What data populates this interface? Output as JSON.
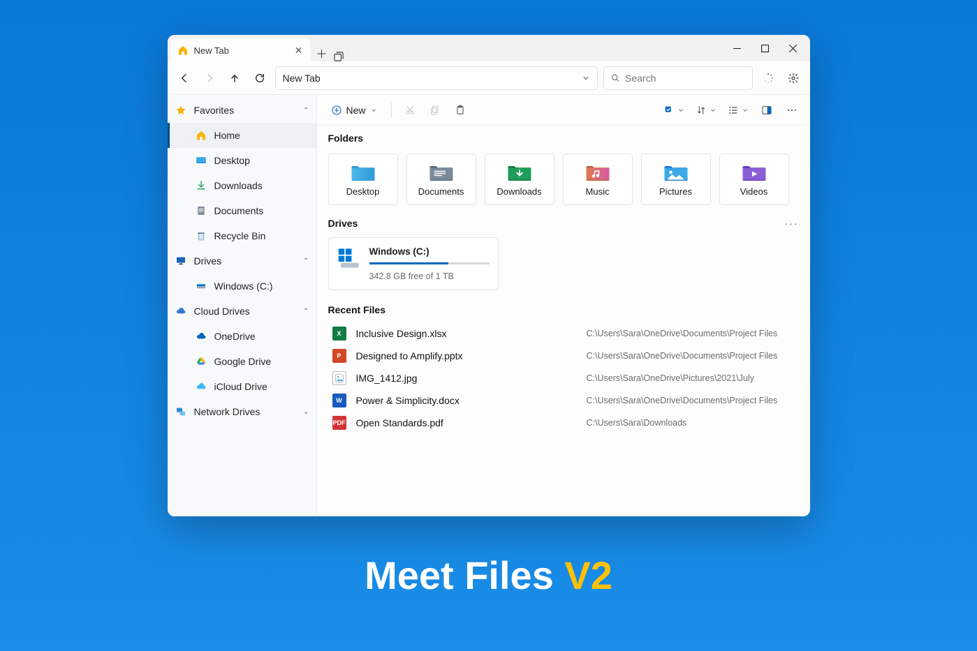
{
  "tab": {
    "title": "New Tab"
  },
  "address": {
    "value": "New Tab"
  },
  "search": {
    "placeholder": "Search"
  },
  "toolbar": {
    "new_label": "New"
  },
  "sidebar": {
    "favorites": {
      "title": "Favorites",
      "items": [
        {
          "label": "Home",
          "icon": "home",
          "active": true
        },
        {
          "label": "Desktop",
          "icon": "desktop"
        },
        {
          "label": "Downloads",
          "icon": "downloads"
        },
        {
          "label": "Documents",
          "icon": "documents"
        },
        {
          "label": "Recycle Bin",
          "icon": "recycle"
        }
      ]
    },
    "drives": {
      "title": "Drives",
      "items": [
        {
          "label": "Windows (C:)",
          "icon": "drive"
        }
      ]
    },
    "cloud": {
      "title": "Cloud Drives",
      "items": [
        {
          "label": "OneDrive",
          "icon": "onedrive"
        },
        {
          "label": "Google Drive",
          "icon": "gdrive"
        },
        {
          "label": "iCloud Drive",
          "icon": "icloud"
        }
      ]
    },
    "network": {
      "title": "Network Drives"
    }
  },
  "sections": {
    "folders": "Folders",
    "drives": "Drives",
    "recent": "Recent Files"
  },
  "folders": [
    {
      "name": "Desktop",
      "kind": "desktop"
    },
    {
      "name": "Documents",
      "kind": "documents"
    },
    {
      "name": "Downloads",
      "kind": "downloads"
    },
    {
      "name": "Music",
      "kind": "music"
    },
    {
      "name": "Pictures",
      "kind": "pictures"
    },
    {
      "name": "Videos",
      "kind": "videos"
    }
  ],
  "drive": {
    "name": "Windows (C:)",
    "free_text": "342.8 GB free of 1 TB",
    "used_fraction": 0.66
  },
  "recent": [
    {
      "name": "Inclusive Design.xlsx",
      "type": "xlsx",
      "path": "C:\\Users\\Sara\\OneDrive\\Documents\\Project Files"
    },
    {
      "name": "Designed to Amplify.pptx",
      "type": "pptx",
      "path": "C:\\Users\\Sara\\OneDrive\\Documents\\Project Files"
    },
    {
      "name": "IMG_1412.jpg",
      "type": "jpg",
      "path": "C:\\Users\\Sara\\OneDrive\\Pictures\\2021\\July"
    },
    {
      "name": "Power & Simplicity.docx",
      "type": "docx",
      "path": "C:\\Users\\Sara\\OneDrive\\Documents\\Project Files"
    },
    {
      "name": "Open Standards.pdf",
      "type": "pdf",
      "path": "C:\\Users\\Sara\\Downloads"
    }
  ],
  "hero": {
    "pre": "Meet Files ",
    "post": "V2"
  }
}
